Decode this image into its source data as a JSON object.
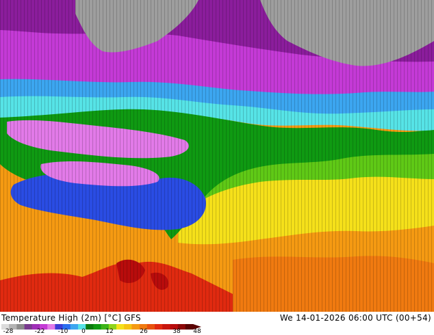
{
  "map": {
    "palette": {
      "ice": "#9e9e9e",
      "deep_violet": "#8b1d9c",
      "magenta": "#c43ad6",
      "pink": "#e27ae8",
      "blue": "#2a4ce3",
      "light_blue": "#3ca6f0",
      "cyan": "#56e3e6",
      "green": "#0f9a12",
      "lime": "#5fc916",
      "yellow": "#f5e01a",
      "orange": "#f59a12",
      "dark_orange": "#f07a10",
      "red": "#e02a10",
      "dark_red": "#b80c0c"
    },
    "contour_label_color": "#000000"
  },
  "footer": {
    "title": "Temperature High (2m) [°C] GFS",
    "timestamp": "We 14-01-2026 06:00 UTC (00+54)"
  },
  "scale": {
    "tick_labels": [
      "-28",
      "-22",
      "-10",
      "0",
      "12",
      "26",
      "38",
      "48"
    ],
    "colors": [
      "#dcdcdc",
      "#b4b4b4",
      "#8c8c8c",
      "#7a3b8f",
      "#a02fb8",
      "#c43ad6",
      "#e27ae8",
      "#3c3cd6",
      "#2a6ef0",
      "#3ca6f0",
      "#56e3e6",
      "#0a7a0e",
      "#0f9a12",
      "#3db418",
      "#8fd41a",
      "#f5e01a",
      "#f5c412",
      "#f59a12",
      "#f07a10",
      "#e8520e",
      "#e02a10",
      "#c8160e",
      "#b80c0c",
      "#8c0808",
      "#5a0404"
    ]
  }
}
